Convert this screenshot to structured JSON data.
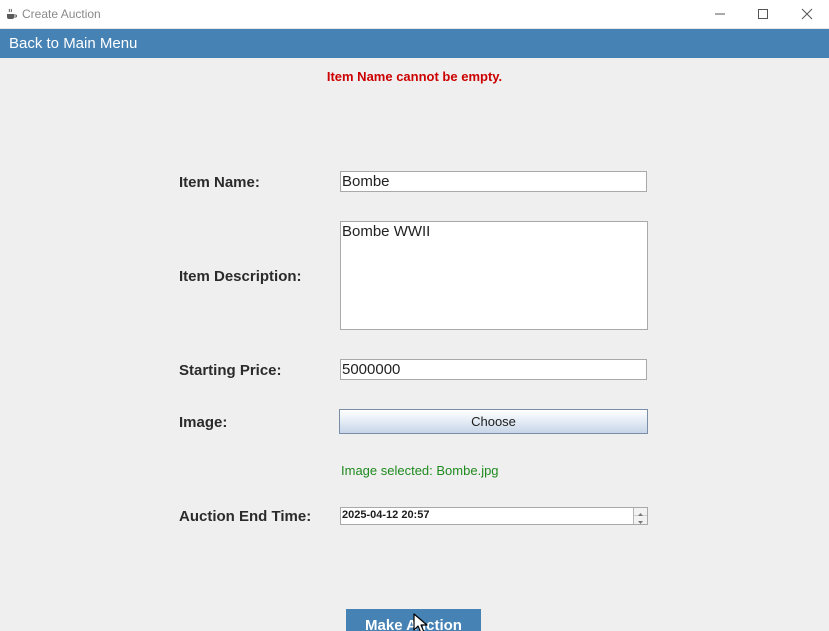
{
  "window": {
    "title": "Create Auction"
  },
  "nav": {
    "back_label": "Back to Main Menu"
  },
  "form": {
    "error_message": "Item Name cannot be empty.",
    "item_name": {
      "label": "Item Name:",
      "value": "Bombe"
    },
    "item_description": {
      "label": "Item Description:",
      "value": "Bombe WWII"
    },
    "starting_price": {
      "label": "Starting Price:",
      "value": "5000000"
    },
    "image": {
      "label": "Image:",
      "button_label": "Choose",
      "status": "Image selected: Bombe.jpg"
    },
    "auction_end_time": {
      "label": "Auction End Time:",
      "value": "2025-04-12 20:57"
    },
    "submit_label": "Make Auction"
  },
  "colors": {
    "accent": "#4682b4",
    "error": "#cc0000",
    "success": "#1f8a1f"
  },
  "icons": {
    "app": "java-cup-icon",
    "minimize": "minimize-icon",
    "maximize": "maximize-icon",
    "close": "close-icon"
  }
}
